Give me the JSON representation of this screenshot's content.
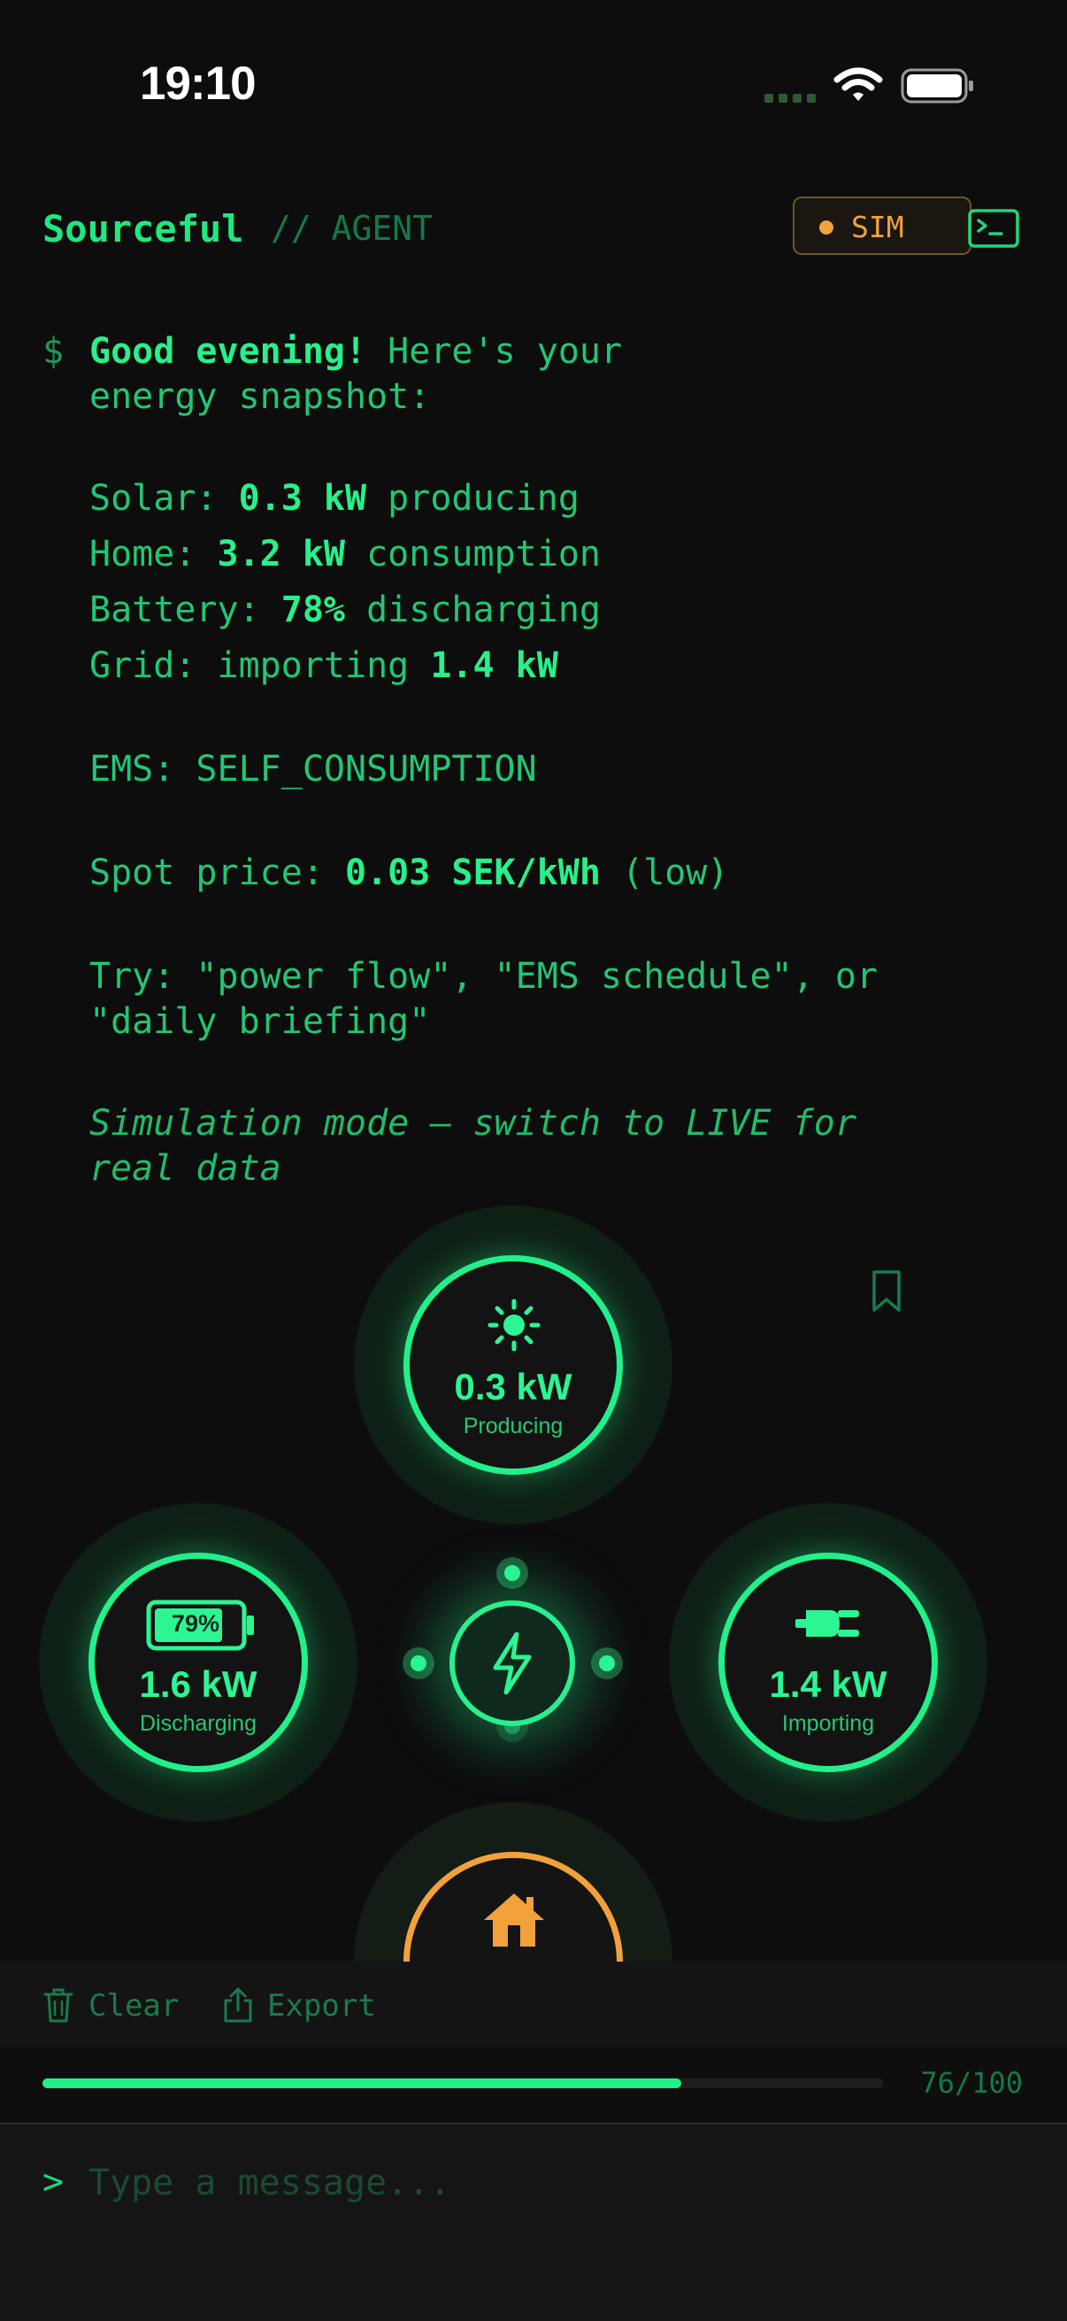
{
  "status_bar": {
    "time": "19:10"
  },
  "header": {
    "brand": "Sourceful",
    "separator": "// AGENT",
    "mode_badge": "SIM"
  },
  "message": {
    "prompt": "$",
    "greeting_bold": "Good evening!",
    "greeting_rest": " Here's your",
    "greeting_line2": "energy snapshot:",
    "solar": {
      "label": "Solar: ",
      "value": "0.3 kW",
      "suffix": " producing"
    },
    "home": {
      "label": "Home: ",
      "value": "3.2 kW",
      "suffix": " consumption"
    },
    "battery": {
      "label": "Battery: ",
      "value": "78%",
      "suffix": " discharging"
    },
    "grid": {
      "label": "Grid: importing ",
      "value": "1.4 kW"
    },
    "ems": "EMS: SELF_CONSUMPTION",
    "spot": {
      "label": "Spot price: ",
      "value": "0.03 SEK/kWh",
      "suffix": " (low)"
    },
    "try_line1": "Try: \"power flow\", \"EMS schedule\", or",
    "try_line2": "\"daily briefing\"",
    "sim_line1": "Simulation mode — switch to LIVE for",
    "sim_line2": "real data"
  },
  "flow": {
    "solar": {
      "value": "0.3 kW",
      "label": "Producing"
    },
    "battery": {
      "percent": "79%",
      "value": "1.6 kW",
      "label": "Discharging"
    },
    "grid": {
      "value": "1.4 kW",
      "label": "Importing"
    }
  },
  "toolbar": {
    "clear_label": "Clear",
    "export_label": "Export"
  },
  "progress": {
    "used": 76,
    "total": 100,
    "text": "76/100"
  },
  "input": {
    "prompt": ">",
    "placeholder": "Type a message..."
  },
  "colors": {
    "accent": "#21f08b",
    "warning": "#f2a13b",
    "background": "#0d0d0d"
  }
}
